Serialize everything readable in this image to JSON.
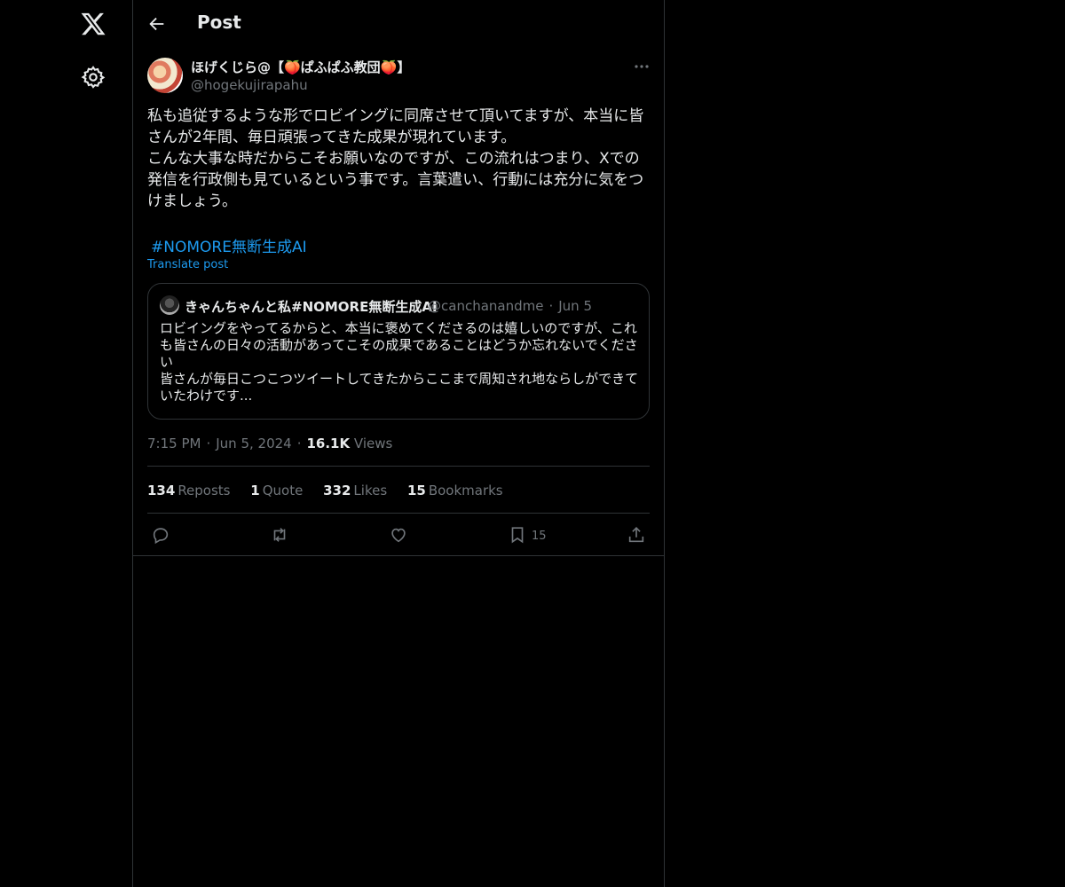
{
  "nav": {
    "logo": "x-logo-icon",
    "settings": "gear-icon"
  },
  "header": {
    "title": "Post",
    "back": "arrow-left-icon"
  },
  "author": {
    "display_name": "ほげくじら@【🍑ぱふぱふ教団🍑】",
    "handle": "@hogekujirapahu"
  },
  "tweet": {
    "lines": [
      "私も追従するような形でロビイングに同席させて頂いてますが、本当に皆さんが2年間、毎日頑張ってきた成果が現れています。",
      "こんな大事な時だからこそお願いなのですが、この流れはつまり、Xでの発信を行政側も見ているという事です。言葉遣い、行動には充分に気をつけましょう。"
    ],
    "hashtag": "#NOMORE無断生成AI",
    "translate": "Translate post"
  },
  "quote": {
    "name": "きゃんちゃんと私#NOMORE無断生成AI",
    "handle": "@canchanandme",
    "date": "Jun 5",
    "lines": [
      "ロビイングをやってるからと、本当に褒めてくださるのは嬉しいのですが、これも皆さんの日々の活動があってこその成果であることはどうか忘れないでください",
      "皆さんが毎日こつこつツイートしてきたからここまで周知され地ならしができていたわけです..."
    ]
  },
  "meta": {
    "time": "7:15 PM",
    "date": "Jun 5, 2024",
    "views_count": "16.1K",
    "views_label": "Views"
  },
  "stats": {
    "reposts_count": "134",
    "reposts_label": "Reposts",
    "quote_count": "1",
    "quote_label": "Quote",
    "likes_count": "332",
    "likes_label": "Likes",
    "bookmarks_count": "15",
    "bookmarks_label": "Bookmarks"
  },
  "actions": {
    "bookmark_count": "15"
  },
  "colors": {
    "background": "#000000",
    "border": "#2f3336",
    "text": "#e7e9ea",
    "muted": "#71767b",
    "link": "#1d9bf0"
  }
}
